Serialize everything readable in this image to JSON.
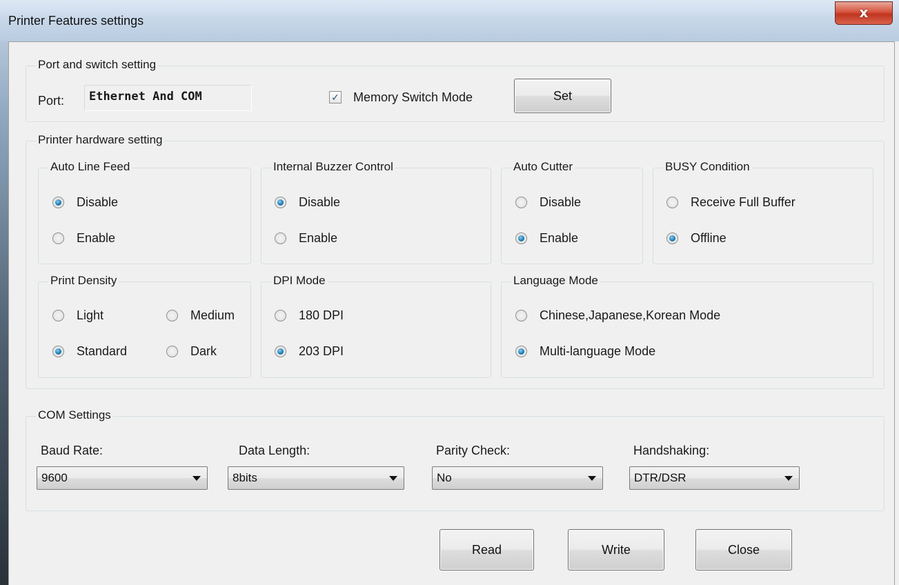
{
  "window": {
    "title": "Printer Features settings",
    "close_glyph": "x"
  },
  "port_group": {
    "label": "Port and switch setting",
    "port_label": "Port:",
    "port_value": "Ethernet And COM",
    "memory_switch_label": "Memory Switch Mode",
    "memory_switch_checked": true,
    "set_button": "Set"
  },
  "hardware_group": {
    "label": "Printer hardware setting",
    "auto_line_feed": {
      "label": "Auto Line Feed",
      "options": [
        "Disable",
        "Enable"
      ],
      "selected": "Disable"
    },
    "internal_buzzer": {
      "label": "Internal Buzzer Control",
      "options": [
        "Disable",
        "Enable"
      ],
      "selected": "Disable"
    },
    "auto_cutter": {
      "label": "Auto Cutter",
      "options": [
        "Disable",
        "Enable"
      ],
      "selected": "Enable"
    },
    "busy_condition": {
      "label": "BUSY Condition",
      "options": [
        "Receive Full Buffer",
        "Offline"
      ],
      "selected": "Offline"
    },
    "print_density": {
      "label": "Print Density",
      "options": [
        "Light",
        "Medium",
        "Standard",
        "Dark"
      ],
      "selected": "Standard"
    },
    "dpi_mode": {
      "label": "DPI Mode",
      "options": [
        "180 DPI",
        "203 DPI"
      ],
      "selected": "203 DPI"
    },
    "language_mode": {
      "label": "Language Mode",
      "options": [
        "Chinese,Japanese,Korean Mode",
        "Multi-language Mode"
      ],
      "selected": "Multi-language Mode"
    }
  },
  "com_group": {
    "label": "COM Settings",
    "baud_rate": {
      "label": "Baud Rate:",
      "value": "9600"
    },
    "data_length": {
      "label": "Data Length:",
      "value": "8bits"
    },
    "parity_check": {
      "label": "Parity Check:",
      "value": "No"
    },
    "handshaking": {
      "label": "Handshaking:",
      "value": "DTR/DSR"
    }
  },
  "footer": {
    "read_button": "Read",
    "write_button": "Write",
    "close_button": "Close"
  }
}
